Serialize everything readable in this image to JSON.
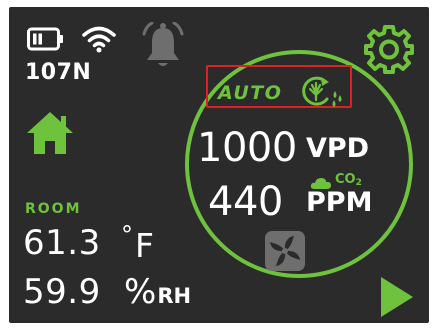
{
  "status": {
    "signal_value": "107N",
    "icons": {
      "battery": "battery-icon",
      "wifi": "wifi-icon",
      "alarm": "bell-icon"
    }
  },
  "navigation": {
    "home": "home-icon",
    "settings": "gear-icon",
    "next": "play-icon"
  },
  "room": {
    "label": "ROOM",
    "temperature": "61.3",
    "temperature_unit_degree": "°",
    "temperature_unit": "F",
    "humidity": "59.9",
    "humidity_unit": "%",
    "humidity_suffix": "RH"
  },
  "controller": {
    "mode": "AUTO",
    "mode_icon": "cycle-leaf-drops-icon",
    "vpd_value": "1000",
    "vpd_unit": "VPD",
    "co2_label": "CO",
    "co2_subscript": "2",
    "co2_value": "440",
    "co2_unit": "PPM",
    "fan_icon": "fan-icon"
  },
  "colors": {
    "background": "#2b2b2b",
    "accent_green": "#6fc23d",
    "highlight_red": "#e02020",
    "text": "#ffffff",
    "muted_icon": "#6e6e6e"
  }
}
